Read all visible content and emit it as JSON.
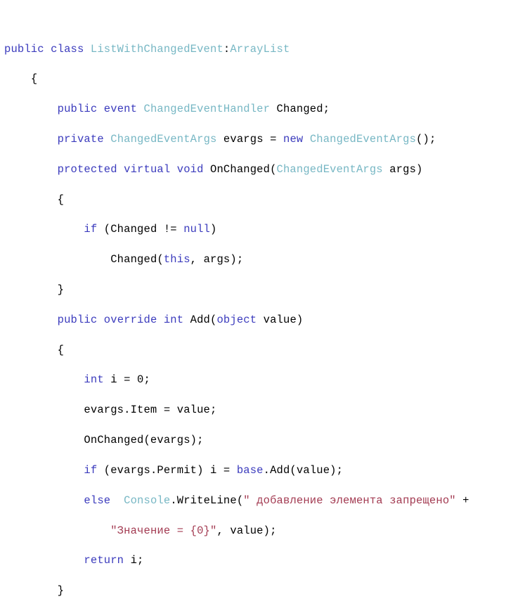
{
  "document": {
    "kind": "code-listing",
    "language": "C#",
    "colors": {
      "background": "#ffffff",
      "keyword": "#3b3bbd",
      "type": "#77b7c4",
      "plain": "#000000",
      "string": "#a33b52"
    },
    "code_lines": [
      {
        "id": "line-1",
        "text": "public class ListWithChangedEvent:ArrayList",
        "tokens": [
          {
            "t": "public class ",
            "c": "keyword"
          },
          {
            "t": "ListWithChangedEvent",
            "c": "type"
          },
          {
            "t": ":",
            "c": "plain"
          },
          {
            "t": "ArrayList",
            "c": "type"
          }
        ]
      },
      {
        "id": "line-2",
        "text": "    {",
        "tokens": [
          {
            "t": "    {",
            "c": "plain"
          }
        ]
      },
      {
        "id": "line-3",
        "text": "        public event ChangedEventHandler Changed;",
        "tokens": [
          {
            "t": "        ",
            "c": "plain"
          },
          {
            "t": "public event ",
            "c": "keyword"
          },
          {
            "t": "ChangedEventHandler",
            "c": "type"
          },
          {
            "t": " Changed;",
            "c": "plain"
          }
        ]
      },
      {
        "id": "line-4",
        "text": "        private ChangedEventArgs evargs = new ChangedEventArgs();",
        "tokens": [
          {
            "t": "        ",
            "c": "plain"
          },
          {
            "t": "private ",
            "c": "keyword"
          },
          {
            "t": "ChangedEventArgs",
            "c": "type"
          },
          {
            "t": " evargs = ",
            "c": "plain"
          },
          {
            "t": "new ",
            "c": "keyword"
          },
          {
            "t": "ChangedEventArgs",
            "c": "type"
          },
          {
            "t": "();",
            "c": "plain"
          }
        ]
      },
      {
        "id": "line-5",
        "text": "        protected virtual void OnChanged(ChangedEventArgs args)",
        "tokens": [
          {
            "t": "        ",
            "c": "plain"
          },
          {
            "t": "protected virtual void ",
            "c": "keyword"
          },
          {
            "t": "OnChanged(",
            "c": "plain"
          },
          {
            "t": "ChangedEventArgs",
            "c": "type"
          },
          {
            "t": " args)",
            "c": "plain"
          }
        ]
      },
      {
        "id": "line-6",
        "text": "        {",
        "tokens": [
          {
            "t": "        {",
            "c": "plain"
          }
        ]
      },
      {
        "id": "line-7",
        "text": "            if (Changed != null)",
        "tokens": [
          {
            "t": "            ",
            "c": "plain"
          },
          {
            "t": "if ",
            "c": "keyword"
          },
          {
            "t": "(Changed != ",
            "c": "plain"
          },
          {
            "t": "null",
            "c": "keyword"
          },
          {
            "t": ")",
            "c": "plain"
          }
        ]
      },
      {
        "id": "line-8",
        "text": "                Changed(this, args);",
        "tokens": [
          {
            "t": "                Changed(",
            "c": "plain"
          },
          {
            "t": "this",
            "c": "keyword"
          },
          {
            "t": ", args);",
            "c": "plain"
          }
        ]
      },
      {
        "id": "line-9",
        "text": "        }",
        "tokens": [
          {
            "t": "        }",
            "c": "plain"
          }
        ]
      },
      {
        "id": "line-10",
        "text": "        public override int Add(object value)",
        "tokens": [
          {
            "t": "        ",
            "c": "plain"
          },
          {
            "t": "public override int ",
            "c": "keyword"
          },
          {
            "t": "Add(",
            "c": "plain"
          },
          {
            "t": "object",
            "c": "keyword"
          },
          {
            "t": " value)",
            "c": "plain"
          }
        ]
      },
      {
        "id": "line-11",
        "text": "        {",
        "tokens": [
          {
            "t": "        {",
            "c": "plain"
          }
        ]
      },
      {
        "id": "line-12",
        "text": "            int i = 0;",
        "tokens": [
          {
            "t": "            ",
            "c": "plain"
          },
          {
            "t": "int",
            "c": "keyword"
          },
          {
            "t": " i = 0;",
            "c": "plain"
          }
        ]
      },
      {
        "id": "line-13",
        "text": "            evargs.Item = value;",
        "tokens": [
          {
            "t": "            evargs.Item = value;",
            "c": "plain"
          }
        ]
      },
      {
        "id": "line-14",
        "text": "            OnChanged(evargs);",
        "tokens": [
          {
            "t": "            OnChanged(evargs);",
            "c": "plain"
          }
        ]
      },
      {
        "id": "line-15",
        "text": "            if (evargs.Permit) i = base.Add(value);",
        "tokens": [
          {
            "t": "            ",
            "c": "plain"
          },
          {
            "t": "if ",
            "c": "keyword"
          },
          {
            "t": "(evargs.Permit) i = ",
            "c": "plain"
          },
          {
            "t": "base",
            "c": "keyword"
          },
          {
            "t": ".Add(value);",
            "c": "plain"
          }
        ]
      },
      {
        "id": "line-16",
        "text": "            else  Console.WriteLine(\" добавление элемента запрещено\" +",
        "tokens": [
          {
            "t": "            ",
            "c": "plain"
          },
          {
            "t": "else",
            "c": "keyword"
          },
          {
            "t": "  ",
            "c": "plain"
          },
          {
            "t": "Console",
            "c": "type"
          },
          {
            "t": ".WriteLine(",
            "c": "plain"
          },
          {
            "t": "\" добавление элемента запрещено\"",
            "c": "string"
          },
          {
            "t": " +",
            "c": "plain"
          }
        ]
      },
      {
        "id": "line-17",
        "text": "                \"Значение = {0}\", value);",
        "tokens": [
          {
            "t": "                ",
            "c": "plain"
          },
          {
            "t": "\"Значение = {0}\"",
            "c": "string"
          },
          {
            "t": ", value);",
            "c": "plain"
          }
        ]
      },
      {
        "id": "line-18",
        "text": "            return i;",
        "tokens": [
          {
            "t": "            ",
            "c": "plain"
          },
          {
            "t": "return",
            "c": "keyword"
          },
          {
            "t": " i;",
            "c": "plain"
          }
        ]
      },
      {
        "id": "line-19",
        "text": "        }",
        "tokens": [
          {
            "t": "        }",
            "c": "plain"
          }
        ]
      }
    ]
  }
}
